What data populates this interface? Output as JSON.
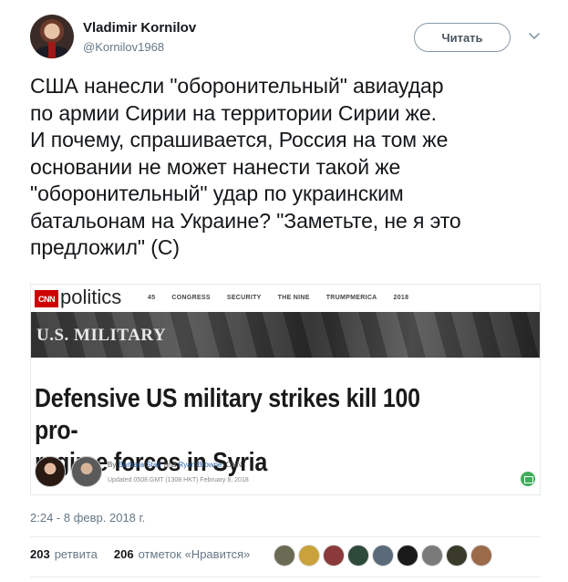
{
  "user": {
    "name": "Vladimir Kornilov",
    "handle": "@Kornilov1968"
  },
  "follow_button": "Читать",
  "tweet_text": "США нанесли \"оборонительный\" авиаудар\nпо армии Сирии на территории Сирии же.\nИ почему, спрашивается, Россия на том же\nосновании не может нанести такой же\n\"оборонительный\" удар по украинским\nбатальонам на Украине? \"Заметьте, не я это\nпредложил\" (С)",
  "card": {
    "logo_text": "CNN",
    "section": "politics",
    "nav": [
      "45",
      "CONGRESS",
      "SECURITY",
      "THE NINE",
      "TRUMPMERICA",
      "2018"
    ],
    "banner": "U.S. MILITARY",
    "headline_line1": "Defensive US military strikes kill 100 pro-",
    "headline_line2": "regime forces in Syria",
    "byline_prefix": "By",
    "byline_author1": "Barbara Starr",
    "byline_and": "and",
    "byline_author2": "Ryan Browne",
    "byline_suffix": ", CNN",
    "updated": "Updated 0508 GMT (1308 HKT) February 8, 2018"
  },
  "timestamp": "2:24 - 8 февр. 2018 г.",
  "stats": {
    "retweets_count": "203",
    "retweets_label": "ретвита",
    "likes_count": "206",
    "likes_label": "отметок «Нравится»"
  },
  "colors": {
    "text": "#14171a",
    "secondary": "#657786",
    "cnn_red": "#cc0000",
    "border": "#e1e8ed"
  },
  "liker_avatars": [
    "avatar-1",
    "avatar-2",
    "avatar-3",
    "avatar-4",
    "avatar-5",
    "avatar-6",
    "avatar-7",
    "avatar-8",
    "avatar-9"
  ]
}
